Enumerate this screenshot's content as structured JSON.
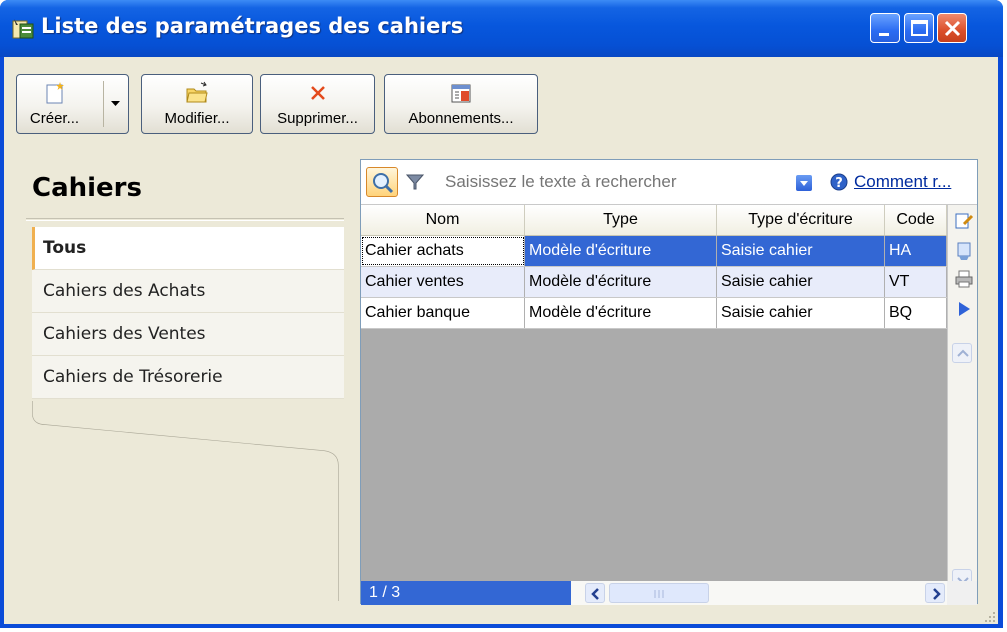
{
  "window": {
    "title": "Liste des paramétrages des cahiers",
    "colors": {
      "titlebar": "#0757dd",
      "client": "#ece9d8",
      "selection": "#3367d4"
    }
  },
  "toolbar": {
    "create_label": "Créer...",
    "modify_label": "Modifier...",
    "delete_label": "Supprimer...",
    "subscriptions_label": "Abonnements..."
  },
  "left_panel": {
    "title": "Cahiers",
    "items": [
      {
        "label": "Tous",
        "active": true
      },
      {
        "label": "Cahiers des Achats",
        "active": false
      },
      {
        "label": "Cahiers des Ventes",
        "active": false
      },
      {
        "label": "Cahiers de Trésorerie",
        "active": false
      }
    ]
  },
  "search": {
    "placeholder": "Saisissez le texte à rechercher",
    "help_link": "Comment r..."
  },
  "table": {
    "columns": [
      "Nom",
      "Type",
      "Type d'écriture",
      "Code"
    ],
    "rows": [
      [
        "Cahier achats",
        "Modèle d'écriture",
        "Saisie cahier",
        "HA"
      ],
      [
        "Cahier ventes",
        "Modèle d'écriture",
        "Saisie cahier",
        "VT"
      ],
      [
        "Cahier banque",
        "Modèle d'écriture",
        "Saisie cahier",
        "BQ"
      ]
    ],
    "selected_row": 0
  },
  "status": {
    "page_indicator": "1 / 3"
  }
}
